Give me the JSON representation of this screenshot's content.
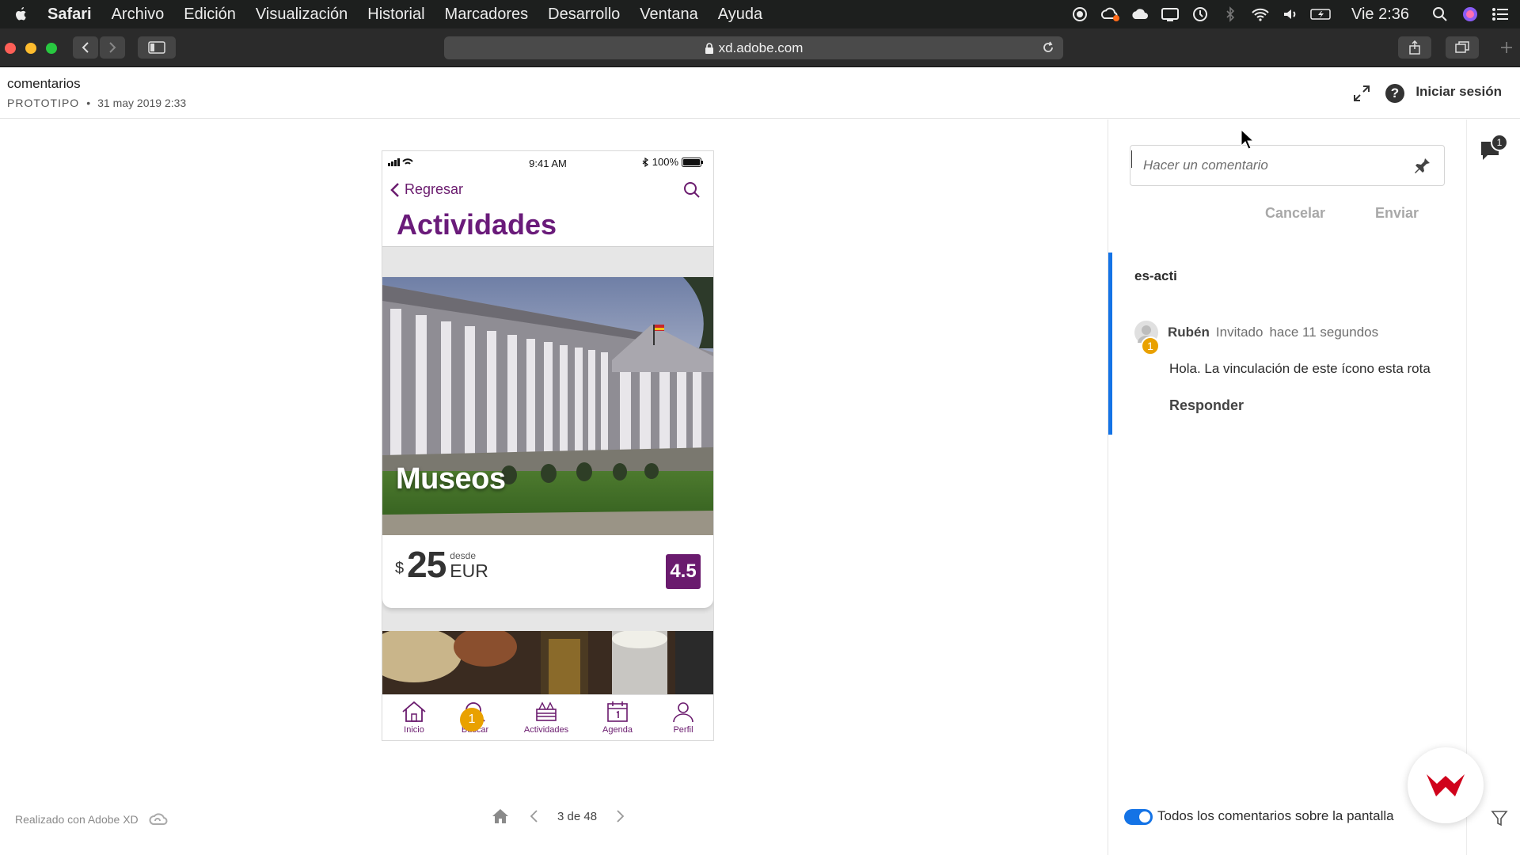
{
  "menubar": {
    "app": "Safari",
    "items": [
      "Archivo",
      "Edición",
      "Visualización",
      "Historial",
      "Marcadores",
      "Desarrollo",
      "Ventana",
      "Ayuda"
    ],
    "clock": "Vie 2:36",
    "status_icons": [
      "record-icon",
      "creative-cloud-icon",
      "cloud-icon",
      "display-icon",
      "time-machine-icon",
      "bluetooth-icon",
      "wifi-icon",
      "volume-icon",
      "battery-icon",
      "spotlight-icon",
      "siri-icon",
      "notification-center-icon"
    ]
  },
  "browser": {
    "url": "xd.adobe.com"
  },
  "header": {
    "title": "comentarios",
    "kind": "PROTOTIPO",
    "date": "31 may 2019 2:33",
    "signin": "Iniciar sesión"
  },
  "phone": {
    "status_time": "9:41 AM",
    "battery": "100%",
    "back_label": "Regresar",
    "title": "Actividades",
    "card": {
      "label": "Museos",
      "currency": "$",
      "amount": "25",
      "from": "desde",
      "unit": "EUR",
      "rating": "4.5"
    },
    "tabs": [
      {
        "label": "Inicio",
        "icon": "home-icon"
      },
      {
        "label": "Buscar",
        "icon": "search-icon"
      },
      {
        "label": "Actividades",
        "icon": "activities-icon"
      },
      {
        "label": "Agenda",
        "icon": "calendar-icon"
      },
      {
        "label": "Perfil",
        "icon": "profile-icon"
      }
    ],
    "tab_badge": "1"
  },
  "footer": {
    "made_with": "Realizado con Adobe XD",
    "page_indicator": "3 de 48"
  },
  "comments": {
    "placeholder": "Hacer un comentario",
    "cancel": "Cancelar",
    "send": "Enviar",
    "thread_title": "es-acti",
    "author": "Rubén",
    "role": "Invitado",
    "time": "hace 11 segundos",
    "badge": "1",
    "body": "Hola. La vinculación de este ícono esta rota",
    "reply": "Responder",
    "toggle_label": "Todos los comentarios sobre la pantalla",
    "count": "1"
  },
  "colors": {
    "accent_purple": "#6a1b6e",
    "accent_blue": "#1473e6",
    "badge_orange": "#e9a100",
    "brand_red": "#d0021b"
  }
}
